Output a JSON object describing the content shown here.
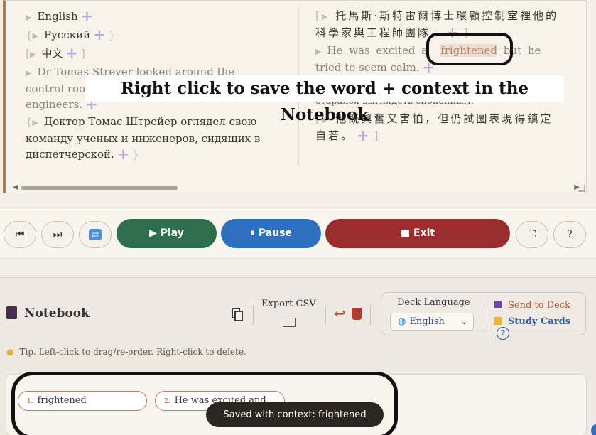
{
  "reader": {
    "left": {
      "lang1": "English",
      "lang2": "Русский",
      "lang3": "中文",
      "en_1": "Dr Tomas Strever looked around the",
      "en_2": "control roo",
      "en_3": "engineers.",
      "ru_1": "Доктор Томас Штрейер оглядел свою",
      "ru_2": "команду ученых и инженеров, сидящих в",
      "ru_3": "диспетчерской."
    },
    "right": {
      "zh_1a": "托馬斯·斯特雷爾博士環顧控制室裡他的",
      "zh_1b": "科學家與工程師團隊。",
      "en_pre": "He was excited a",
      "en_hl": "frightened",
      "en_post": "but he",
      "en_line2": "tried to seem calm.",
      "ru_cut": "старался выглядеть спокойным.",
      "zh_2a": "他既興奮又害怕，但仍試圖表現得鎮定",
      "zh_2b": "自若。"
    }
  },
  "annotation": {
    "banner": "Right click to save the word + context in the Notebook"
  },
  "controls": {
    "prev_icon": "⏮",
    "next_icon": "⏭",
    "loop_icon": "⇄",
    "play": "▶ Play",
    "pause": "⏸ Pause",
    "exit": "■ Exit",
    "fullscreen_icon": "⛶",
    "help": "?"
  },
  "notebook": {
    "title": "Notebook",
    "export_label": "Export CSV",
    "deck_language_label": "Deck Language",
    "deck_language_value": "English",
    "send_to_deck": "Send to Deck",
    "study_cards": "Study Cards",
    "help": "?",
    "tip": "Tip. Left-click to drag/re-order. Right-click to delete.",
    "items": [
      {
        "num": "1.",
        "text": "frightened"
      },
      {
        "num": "2.",
        "text": "He was excited and"
      }
    ],
    "toast": "Saved with context: frightened"
  }
}
